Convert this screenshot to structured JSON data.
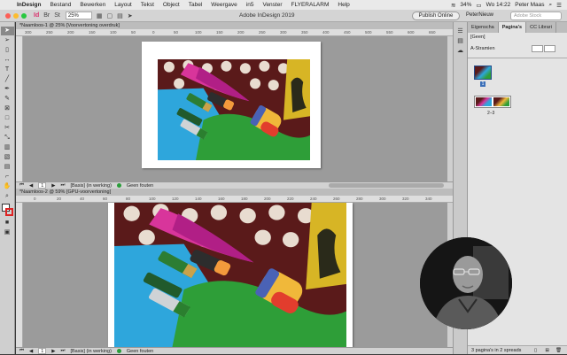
{
  "menubar": {
    "items": [
      "InDesign",
      "Bestand",
      "Bewerken",
      "Layout",
      "Tekst",
      "Object",
      "Tabel",
      "Weergave",
      "in5",
      "Venster",
      "FLYERALARM",
      "Help"
    ],
    "battery": "34%",
    "clock": "Wo 14:22",
    "user": "Peter Maas"
  },
  "appbar": {
    "title": "Adobe InDesign 2019",
    "zoom": "25%",
    "publish_label": "Publish Online",
    "workspace": "PeterNieuw",
    "stock_placeholder": "Adobe Stock"
  },
  "doc1": {
    "tab": "*Naamloos-1 @ 25% [Voorvertoning overdruk]",
    "ruler_marks": [
      "300",
      "250",
      "200",
      "150",
      "100",
      "50",
      "0",
      "50",
      "100",
      "150",
      "200",
      "250",
      "300",
      "350",
      "400",
      "450",
      "500",
      "550",
      "600",
      "650"
    ],
    "page_num": "1",
    "style": "[Basis] (in werking)",
    "preflight": "Geen fouten"
  },
  "doc2": {
    "tab": "*Naamloos-2 @ 59% [GPU-voorvertoning]",
    "ruler_marks": [
      "0",
      "20",
      "40",
      "60",
      "80",
      "100",
      "120",
      "140",
      "160",
      "180",
      "200",
      "220",
      "240",
      "260",
      "280",
      "300",
      "320",
      "340"
    ],
    "page_num": "1",
    "style": "[Basis] (in werking)",
    "preflight": "Geen fouten"
  },
  "panel": {
    "tabs": [
      "Eigenscha",
      "Pagina's",
      "CC Librari"
    ],
    "none_label": "[Geen]",
    "master_label": "A-Stramien",
    "page1": "1",
    "spread_label": "2–3",
    "footer": "3 pagina's in 2 spreads"
  },
  "colors": {
    "accent_green": "#2a9d3a",
    "publish_bg": "#eeeeee",
    "canvas_bg": "#9b9b9b"
  },
  "icons": {
    "tools": [
      "selection-icon",
      "direct-selection-icon",
      "page-tool-icon",
      "gap-tool-icon",
      "type-icon",
      "line-icon",
      "pen-icon",
      "pencil-icon",
      "rect-frame-icon",
      "rect-icon",
      "scissors-icon",
      "transform-icon",
      "gradient-icon",
      "note-icon",
      "eyedropper-icon",
      "hand-icon",
      "zoom-icon"
    ]
  }
}
